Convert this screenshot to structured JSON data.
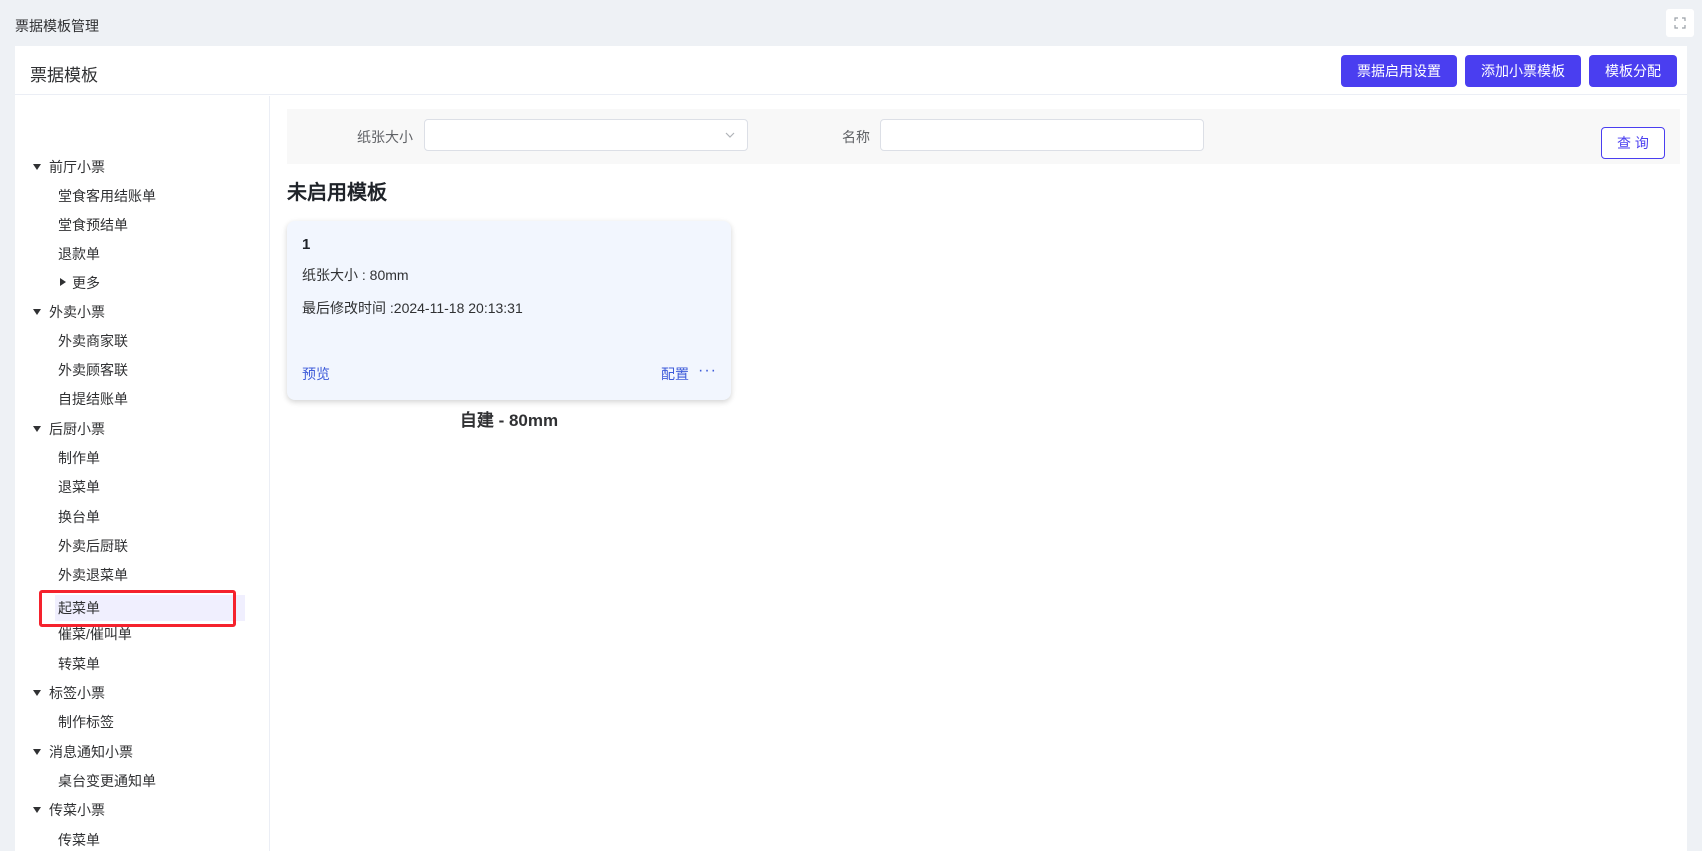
{
  "topbar": {
    "title": "票据模板管理"
  },
  "header": {
    "title": "票据模板",
    "buttons": {
      "enable_settings": "票据启用设置",
      "add_template": "添加小票模板",
      "assign_template": "模板分配"
    }
  },
  "sidebar": {
    "groups": [
      {
        "label": "前厅小票",
        "items": [
          "堂食客用结账单",
          "堂食预结单",
          "退款单"
        ],
        "more": "更多"
      },
      {
        "label": "外卖小票",
        "items": [
          "外卖商家联",
          "外卖顾客联",
          "自提结账单"
        ]
      },
      {
        "label": "后厨小票",
        "items": [
          "制作单",
          "退菜单",
          "换台单",
          "外卖后厨联",
          "外卖退菜单",
          "起菜单",
          "催菜/催叫单",
          "转菜单"
        ]
      },
      {
        "label": "标签小票",
        "items": [
          "制作标签"
        ]
      },
      {
        "label": "消息通知小票",
        "items": [
          "桌台变更通知单"
        ]
      },
      {
        "label": "传菜小票",
        "items": [
          "传菜单"
        ]
      }
    ],
    "selected_item": "起菜单"
  },
  "filter": {
    "paper_size_label": "纸张大小",
    "paper_size_value": "",
    "name_label": "名称",
    "name_value": "",
    "query_button": "查 询"
  },
  "section": {
    "title": "未启用模板"
  },
  "cards": [
    {
      "name": "1",
      "paper_size_line": "纸张大小 : 80mm",
      "modified_line": "最后修改时间 :2024-11-18 20:13:31",
      "preview_link": "预览",
      "config_link": "配置",
      "more": "···",
      "caption": "自建 - 80mm"
    }
  ],
  "colors": {
    "primary": "#4a3ef0",
    "link": "#3d5bd9",
    "highlight": "#f5222d",
    "card_bg": "#f2f6fe"
  }
}
